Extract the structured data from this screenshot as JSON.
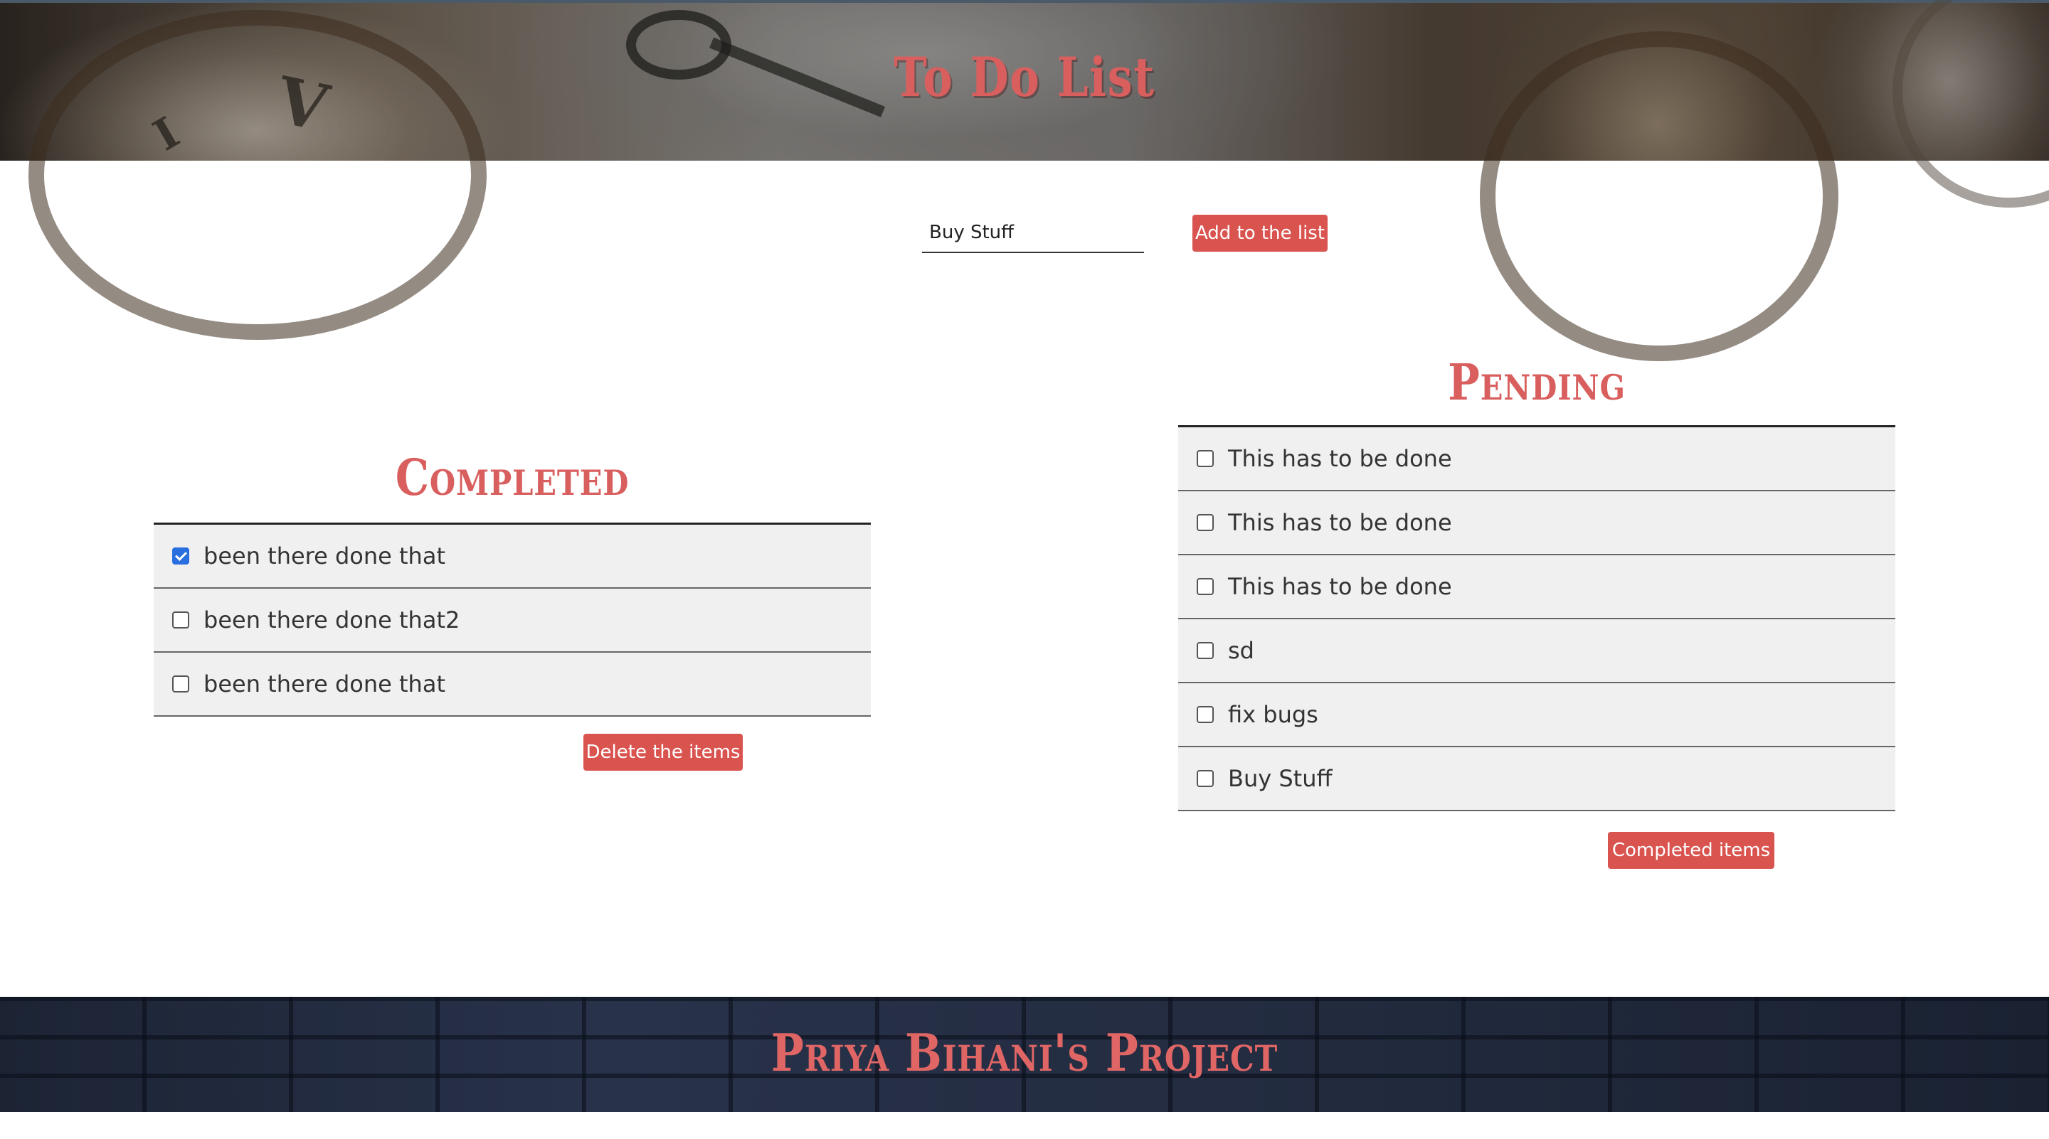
{
  "header": {
    "title": "To Do List"
  },
  "input": {
    "value": "Buy Stuff",
    "add_button_label": "Add to the list"
  },
  "completed": {
    "title": "Completed",
    "items": [
      {
        "label": "been there done that",
        "checked": true
      },
      {
        "label": "been there done that2",
        "checked": false
      },
      {
        "label": "been there done that",
        "checked": false
      }
    ],
    "delete_button_label": "Delete the items"
  },
  "pending": {
    "title": "Pending",
    "items": [
      {
        "label": "This has to be done",
        "checked": false
      },
      {
        "label": "This has to be done",
        "checked": false
      },
      {
        "label": "This has to be done",
        "checked": false
      },
      {
        "label": "sd",
        "checked": false
      },
      {
        "label": "fix bugs",
        "checked": false
      },
      {
        "label": "Buy Stuff",
        "checked": false
      }
    ],
    "completed_button_label": "Completed items"
  },
  "footer": {
    "text": "Priya Bihani's Project"
  },
  "colors": {
    "accent": "#d9534f",
    "title_red": "#d95f5f",
    "checkbox_blue": "#2a6fe0",
    "list_bg": "#f0f0f0"
  }
}
